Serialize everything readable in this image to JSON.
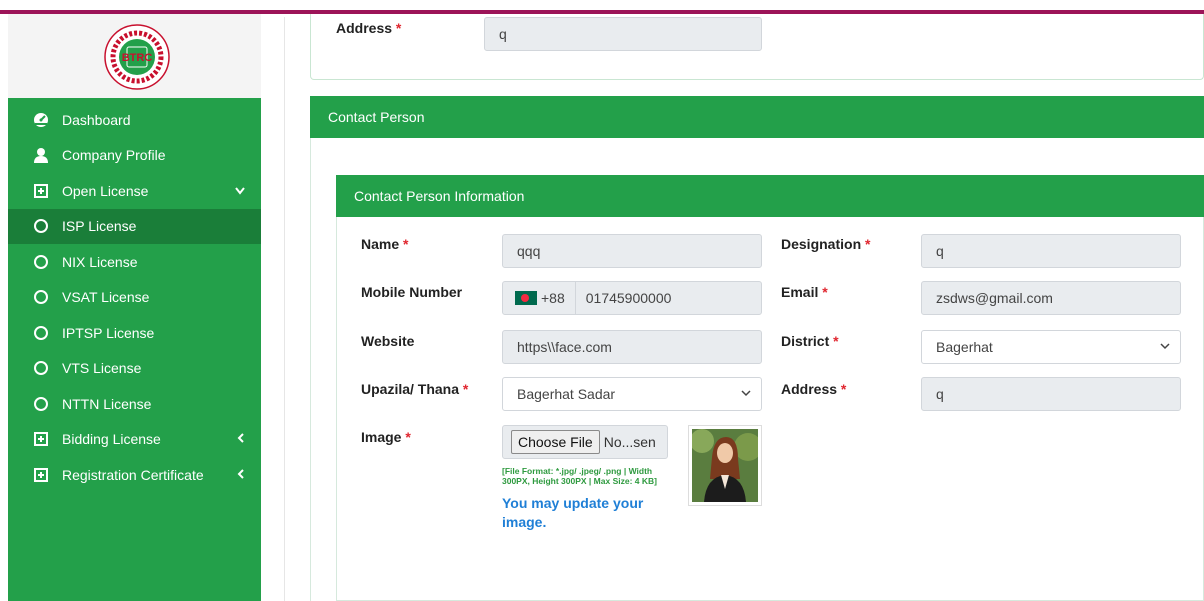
{
  "brand": {
    "logo_text": "BTRC",
    "logo_icon": "btrc-logo"
  },
  "sidebar": {
    "items": [
      {
        "label": "Dashboard",
        "icon": "dashboard-icon"
      },
      {
        "label": "Company Profile",
        "icon": "user-icon"
      },
      {
        "label": "Open License",
        "icon": "plus-square-icon",
        "caret": "˅"
      },
      {
        "label": "ISP License",
        "icon": "circle-icon"
      },
      {
        "label": "NIX License",
        "icon": "circle-icon"
      },
      {
        "label": "VSAT License",
        "icon": "circle-icon"
      },
      {
        "label": "IPTSP License",
        "icon": "circle-icon"
      },
      {
        "label": "VTS License",
        "icon": "circle-icon"
      },
      {
        "label": "NTTN License",
        "icon": "circle-icon"
      },
      {
        "label": "Bidding License",
        "icon": "plus-square-icon",
        "caret": "‹"
      },
      {
        "label": "Registration Certificate",
        "icon": "plus-square-icon",
        "caret": "‹"
      }
    ]
  },
  "address_section": {
    "label": "Address",
    "required": "*",
    "value": "q"
  },
  "contact_person": {
    "header": "Contact Person"
  },
  "contact_info": {
    "header": "Contact Person Information",
    "name": {
      "label": "Name",
      "required": "*",
      "value": "qqq"
    },
    "designation": {
      "label": "Designation",
      "required": "*",
      "value": "q"
    },
    "mobile": {
      "label": "Mobile Number",
      "country_code": "+88",
      "value": "01745900000"
    },
    "email": {
      "label": "Email",
      "required": "*",
      "value": "zsdws@gmail.com"
    },
    "website": {
      "label": "Website",
      "value": "https\\\\face.com"
    },
    "district": {
      "label": "District",
      "required": "*",
      "value": "Bagerhat"
    },
    "upazila": {
      "label": "Upazila/ Thana",
      "required": "*",
      "value": "Bagerhat Sadar"
    },
    "address": {
      "label": "Address",
      "required": "*",
      "value": "q"
    },
    "image": {
      "label": "Image",
      "required": "*",
      "button": "Choose File",
      "file_text": "No...sen",
      "hint": "[File Format: *.jpg/ .jpeg/ .png | Width 300PX, Height 300PX | Max Size: 4 KB]",
      "update_text": "You may update your image."
    }
  },
  "colors": {
    "primary": "#23a04a",
    "active": "#1a7e39",
    "accent_bar": "#9c1458",
    "required": "#e0262f",
    "link": "#1f7fd6"
  }
}
